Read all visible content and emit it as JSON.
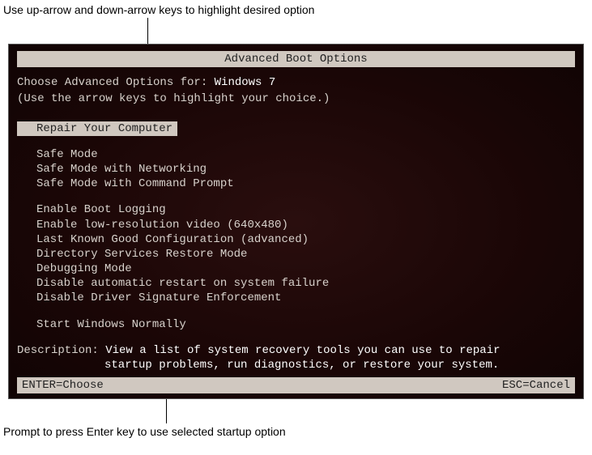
{
  "callouts": {
    "top": "Use up-arrow and down-arrow keys to highlight desired option",
    "bottom": "Prompt to press Enter key to use selected startup option"
  },
  "title": "Advanced Boot Options",
  "prompt_prefix": "Choose Advanced Options for: ",
  "os_name": "Windows 7",
  "hint": "(Use the arrow keys to highlight your choice.)",
  "selected_label": "Repair Your Computer",
  "group_safe": [
    "Safe Mode",
    "Safe Mode with Networking",
    "Safe Mode with Command Prompt"
  ],
  "group_advanced": [
    "Enable Boot Logging",
    "Enable low-resolution video (640x480)",
    "Last Known Good Configuration (advanced)",
    "Directory Services Restore Mode",
    "Debugging Mode",
    "Disable automatic restart on system failure",
    "Disable Driver Signature Enforcement"
  ],
  "group_normal": [
    "Start Windows Normally"
  ],
  "description_label": "Description: ",
  "description_line1": "View a list of system recovery tools you can use to repair",
  "description_line2": "startup problems, run diagnostics, or restore your system.",
  "footer_left": "ENTER=Choose",
  "footer_right": "ESC=Cancel"
}
